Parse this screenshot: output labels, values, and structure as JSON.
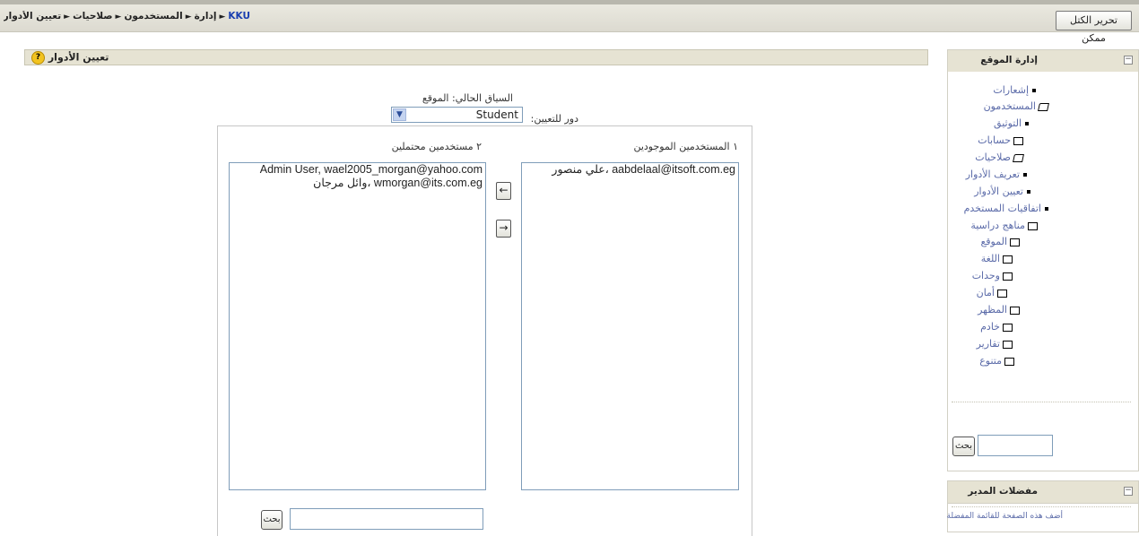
{
  "navbar": {
    "breadcrumb": [
      "KKU",
      "إدارة",
      "المستخدمون",
      "صلاحيات",
      "تعيين الأدوار"
    ],
    "separator": "►",
    "turn_editing_label": "تحرير الكتل ممكن"
  },
  "heading": {
    "title": "تعيين الأدوار",
    "help": "?"
  },
  "context": {
    "current_context": "السياق الحالي: الموقع",
    "role_label": "دور للتعيين:",
    "role_value": "Student"
  },
  "assign": {
    "existing_label": "١ المستخدمين الموجودين",
    "potential_label": "٢ مستخدمين محتملين",
    "existing_users": [
      "علي منصور، aabdelaal@itsoft.com.eg"
    ],
    "potential_users": [
      "Admin User, wael2005_morgan@yahoo.com",
      "وائل مرجان، wmorgan@its.com.eg"
    ],
    "add_arrow": "←",
    "remove_arrow": "→",
    "search_button": "بحث"
  },
  "site_admin": {
    "title": "إدارة الموقع",
    "collapse": "−",
    "items": [
      {
        "label": "إشعارات",
        "icon": "bullet"
      },
      {
        "label": "المستخدمون",
        "icon": "folder-open"
      },
      {
        "label": "التوثيق",
        "icon": "bullet"
      },
      {
        "label": "حسابات",
        "icon": "folder"
      },
      {
        "label": "صلاحيات",
        "icon": "folder-open"
      },
      {
        "label": "تعريف الأدوار",
        "icon": "bullet"
      },
      {
        "label": "تعيين الأدوار",
        "icon": "bullet"
      },
      {
        "label": "اتفاقيات المستخدم",
        "icon": "bullet"
      },
      {
        "label": "مناهج دراسية",
        "icon": "folder"
      },
      {
        "label": "الموقع",
        "icon": "folder"
      },
      {
        "label": "اللغة",
        "icon": "folder"
      },
      {
        "label": "وحدات",
        "icon": "folder"
      },
      {
        "label": "أمان",
        "icon": "folder"
      },
      {
        "label": "المظهر",
        "icon": "folder"
      },
      {
        "label": "خادم",
        "icon": "folder"
      },
      {
        "label": "تقارير",
        "icon": "folder"
      },
      {
        "label": "متنوع",
        "icon": "folder"
      }
    ],
    "search_button": "بحث"
  },
  "bookmarks": {
    "title": "مفضلات المدير",
    "collapse": "−",
    "link": "أضف هذه الصفحة للقائمة المفضلة"
  }
}
